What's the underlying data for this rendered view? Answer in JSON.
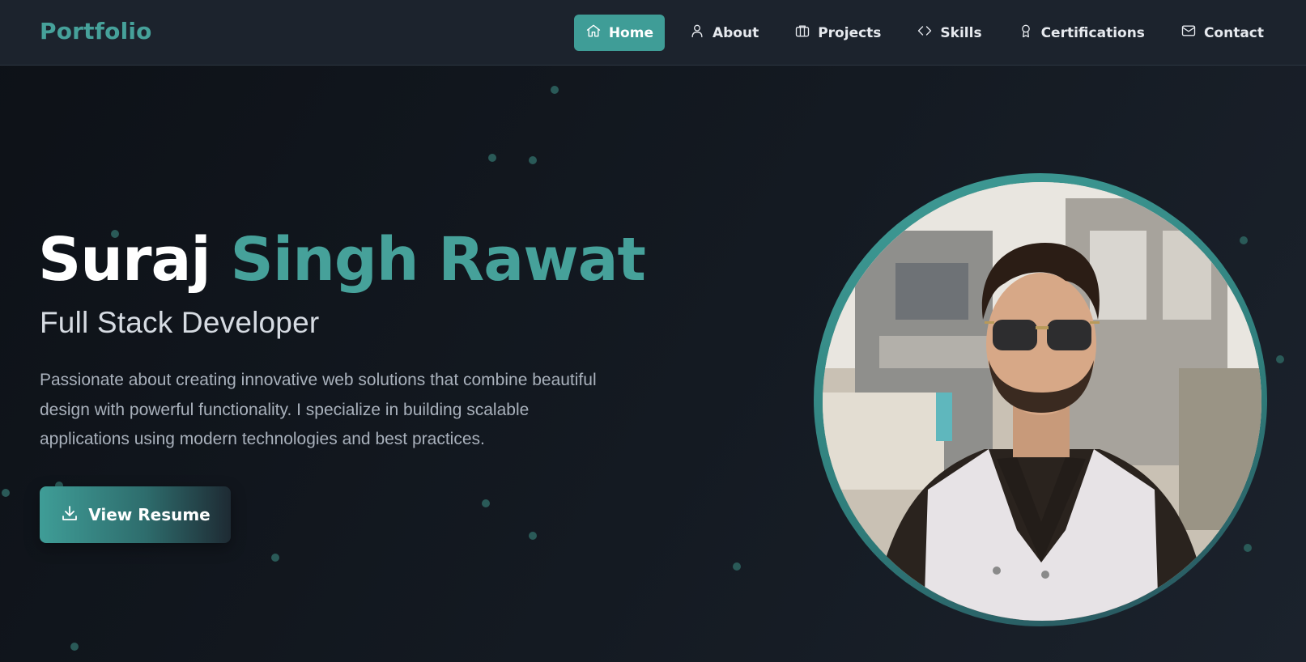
{
  "brand": "Portfolio",
  "nav": [
    {
      "label": "Home",
      "icon": "home-icon",
      "active": true
    },
    {
      "label": "About",
      "icon": "user-icon",
      "active": false
    },
    {
      "label": "Projects",
      "icon": "briefcase-icon",
      "active": false
    },
    {
      "label": "Skills",
      "icon": "code-icon",
      "active": false
    },
    {
      "label": "Certifications",
      "icon": "award-icon",
      "active": false
    },
    {
      "label": "Contact",
      "icon": "mail-icon",
      "active": false
    }
  ],
  "hero": {
    "first_name": "Suraj",
    "last_name": "Singh Rawat",
    "role": "Full Stack Developer",
    "description": "Passionate about creating innovative web solutions that combine beautiful design with powerful functionality. I specialize in building scalable applications using modern technologies and best practices.",
    "cta_label": "View Resume",
    "cta_icon": "download-icon"
  },
  "colors": {
    "accent": "#46a19a",
    "background": "#11161d",
    "navbar": "#1c232d"
  }
}
